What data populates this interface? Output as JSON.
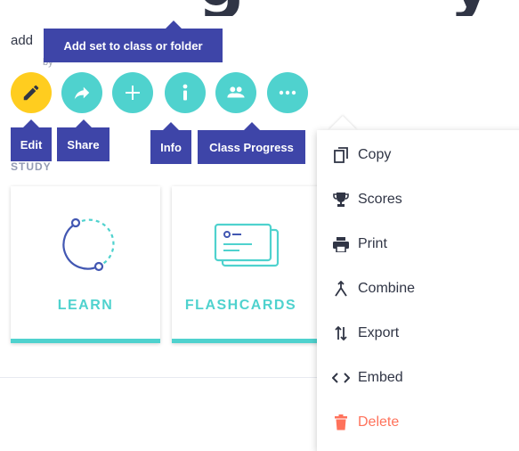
{
  "title": {
    "partial": "g",
    "partial2": "y"
  },
  "add_text": "add",
  "toolbar": {
    "buttons": [
      {
        "id": "edit",
        "icon": "pencil-icon"
      },
      {
        "id": "share",
        "icon": "share-arrow-icon"
      },
      {
        "id": "add",
        "icon": "plus-icon"
      },
      {
        "id": "info",
        "icon": "info-icon"
      },
      {
        "id": "class-progress",
        "icon": "people-icon"
      },
      {
        "id": "more",
        "icon": "ellipsis-icon"
      }
    ],
    "tooltips": {
      "add_set": "Add set to class or folder",
      "edit": "Edit",
      "share": "Share",
      "info": "Info",
      "class_progress": "Class Progress"
    }
  },
  "study_heading": "STUDY",
  "cards": [
    {
      "label": "LEARN",
      "icon": "learn-circle-icon"
    },
    {
      "label": "FLASHCARDS",
      "icon": "flashcards-icon"
    }
  ],
  "menu": {
    "items": [
      {
        "label": "Copy",
        "icon": "copy-icon"
      },
      {
        "label": "Scores",
        "icon": "trophy-icon"
      },
      {
        "label": "Print",
        "icon": "printer-icon"
      },
      {
        "label": "Combine",
        "icon": "combine-icon"
      },
      {
        "label": "Export",
        "icon": "export-icon"
      },
      {
        "label": "Embed",
        "icon": "embed-icon"
      },
      {
        "label": "Delete",
        "icon": "trash-icon"
      }
    ]
  },
  "colors": {
    "accent_teal": "#4fd2ce",
    "edit_yellow": "#ffcd1f",
    "tooltip_indigo": "#3e45a8",
    "delete_red": "#ff725b",
    "text_dark": "#303545"
  }
}
